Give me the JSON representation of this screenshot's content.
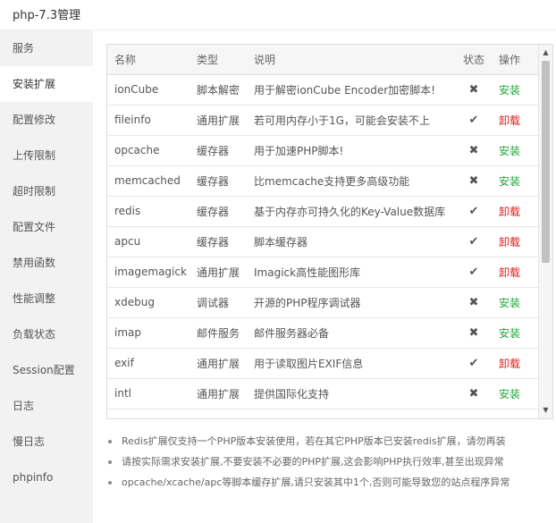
{
  "window": {
    "title": "php-7.3管理"
  },
  "sidebar": {
    "items": [
      {
        "label": "服务"
      },
      {
        "label": "安装扩展"
      },
      {
        "label": "配置修改"
      },
      {
        "label": "上传限制"
      },
      {
        "label": "超时限制"
      },
      {
        "label": "配置文件"
      },
      {
        "label": "禁用函数"
      },
      {
        "label": "性能调整"
      },
      {
        "label": "负载状态"
      },
      {
        "label": "Session配置"
      },
      {
        "label": "日志"
      },
      {
        "label": "慢日志"
      },
      {
        "label": "phpinfo"
      }
    ],
    "active_index": 1
  },
  "table": {
    "headers": {
      "name": "名称",
      "type": "类型",
      "desc": "说明",
      "status": "状态",
      "action": "操作"
    },
    "rows": [
      {
        "name": "ionCube",
        "type": "脚本解密",
        "desc": "用于解密ionCube Encoder加密脚本!",
        "status": "✖",
        "installed": false,
        "action": "安装"
      },
      {
        "name": "fileinfo",
        "type": "通用扩展",
        "desc": "若可用内存小于1G，可能会安装不上",
        "status": "✔",
        "installed": true,
        "action": "卸载"
      },
      {
        "name": "opcache",
        "type": "缓存器",
        "desc": "用于加速PHP脚本!",
        "status": "✖",
        "installed": false,
        "action": "安装"
      },
      {
        "name": "memcached",
        "type": "缓存器",
        "desc": "比memcache支持更多高级功能",
        "status": "✖",
        "installed": false,
        "action": "安装"
      },
      {
        "name": "redis",
        "type": "缓存器",
        "desc": "基于内存亦可持久化的Key-Value数据库",
        "status": "✔",
        "installed": true,
        "action": "卸载"
      },
      {
        "name": "apcu",
        "type": "缓存器",
        "desc": "脚本缓存器",
        "status": "✔",
        "installed": true,
        "action": "卸载"
      },
      {
        "name": "imagemagick",
        "type": "通用扩展",
        "desc": "Imagick高性能图形库",
        "status": "✔",
        "installed": true,
        "action": "卸载"
      },
      {
        "name": "xdebug",
        "type": "调试器",
        "desc": "开源的PHP程序调试器",
        "status": "✖",
        "installed": false,
        "action": "安装"
      },
      {
        "name": "imap",
        "type": "邮件服务",
        "desc": "邮件服务器必备",
        "status": "✖",
        "installed": false,
        "action": "安装"
      },
      {
        "name": "exif",
        "type": "通用扩展",
        "desc": "用于读取图片EXIF信息",
        "status": "✔",
        "installed": true,
        "action": "卸载"
      },
      {
        "name": "intl",
        "type": "通用扩展",
        "desc": "提供国际化支持",
        "status": "✖",
        "installed": false,
        "action": "安装"
      },
      {
        "name": "",
        "type": "",
        "desc": "",
        "status": "",
        "installed": false,
        "action": ""
      }
    ]
  },
  "scrollbar": {
    "up": "▲",
    "down": "▼"
  },
  "notes": [
    "Redis扩展仅支持一个PHP版本安装使用，若在其它PHP版本已安装redis扩展，请勿再装",
    "请按实际需求安装扩展,不要安装不必要的PHP扩展,这会影响PHP执行效率,甚至出现异常",
    "opcache/xcache/apc等脚本缓存扩展,请只安装其中1个,否则可能导致您的站点程序异常"
  ],
  "colors": {
    "install": "#20a53a",
    "uninstall": "#e01a1a",
    "sidebar_bg": "#f2f2f2"
  }
}
